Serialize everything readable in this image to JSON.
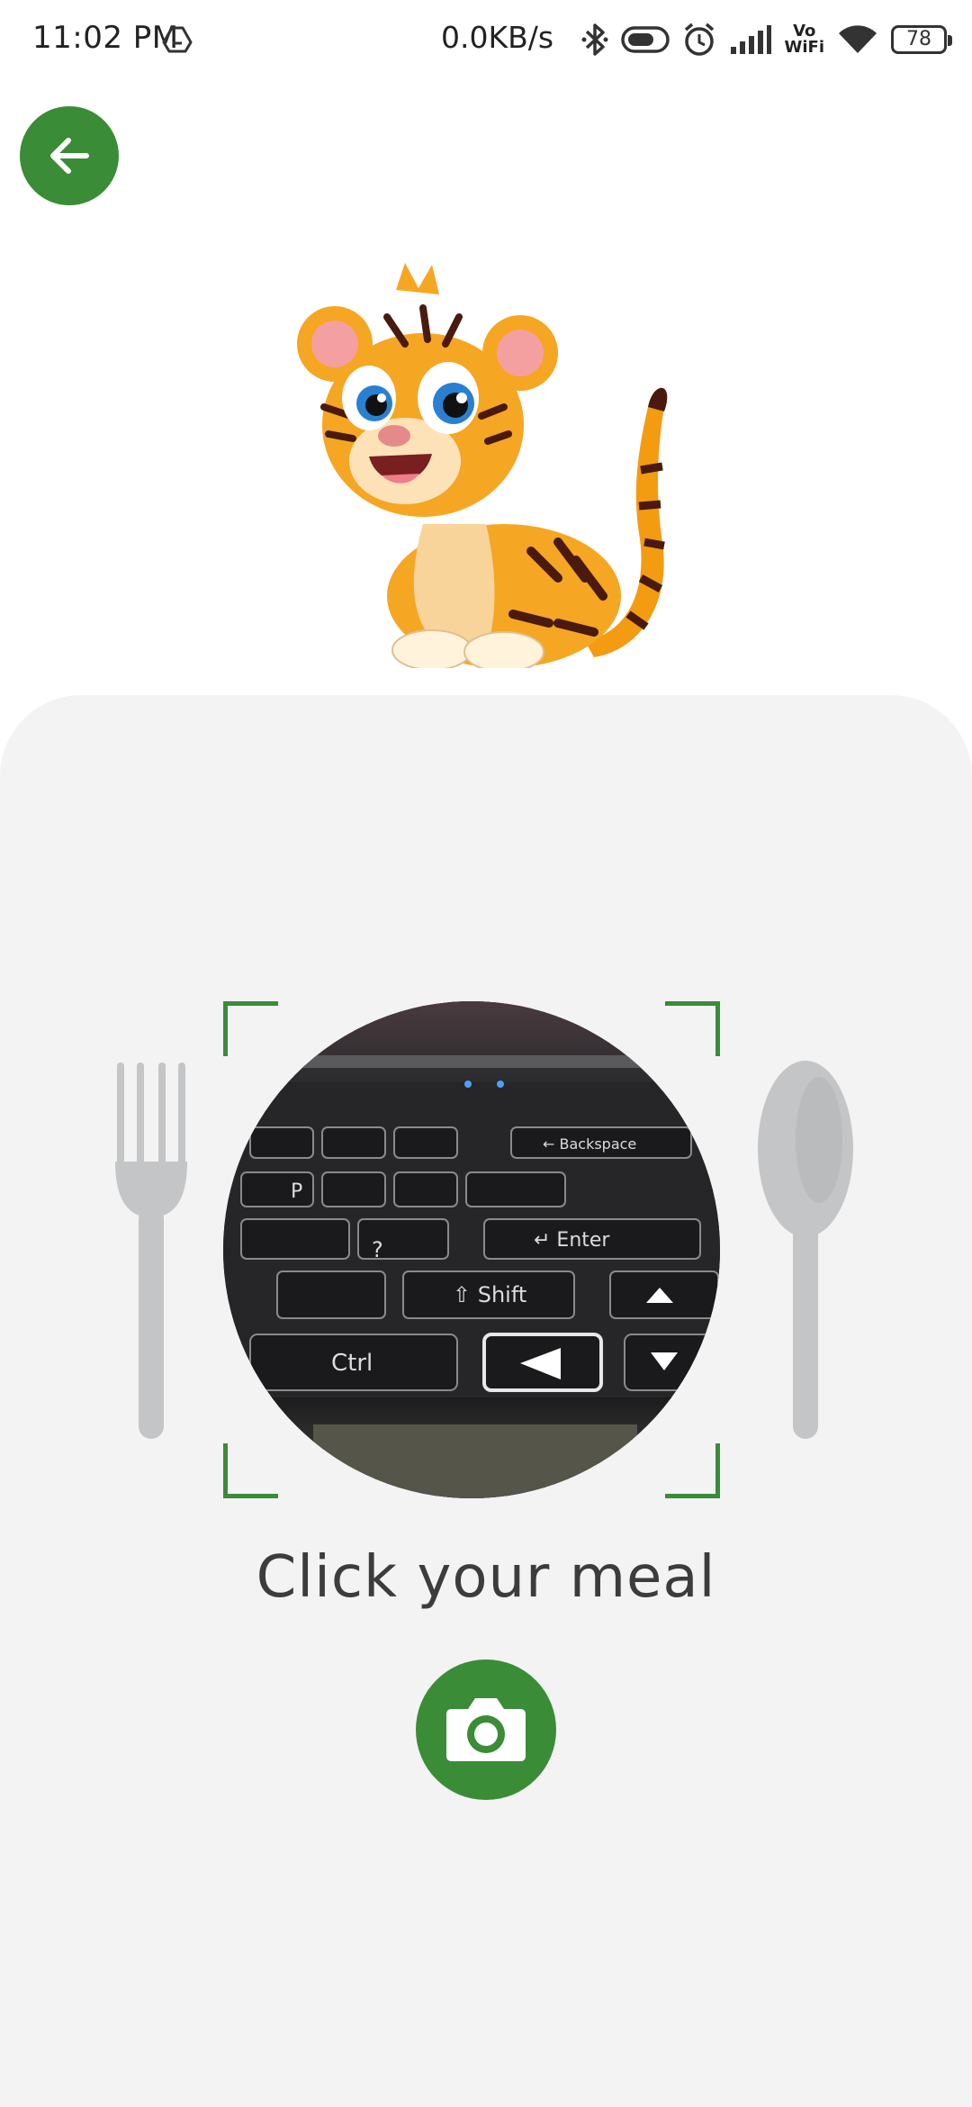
{
  "status_bar": {
    "time": "11:02 PM",
    "network_speed": "0.0KB/s",
    "vowifi_label_top": "Vo",
    "vowifi_label_bottom": "WiFi",
    "battery_level": "78",
    "icons": [
      "drive-icon",
      "bluetooth-icon",
      "toggle-icon",
      "alarm-icon",
      "signal-icon",
      "wifi-icon",
      "battery-icon"
    ]
  },
  "header": {
    "back_icon": "arrow-left-icon"
  },
  "main": {
    "prompt_text": "Click your meal",
    "camera_icon": "camera-icon",
    "preview_keys": {
      "backspace": "← Backspace",
      "enter": "↵ Enter",
      "shift": "⇧ Shift",
      "ctrl": "Ctrl",
      "p": "P",
      "question": "?"
    }
  },
  "colors": {
    "accent": "#3a8c36",
    "panel_bg": "#f3f3f3",
    "text": "#3c3c3c",
    "cutlery": "#c4c5c7"
  }
}
